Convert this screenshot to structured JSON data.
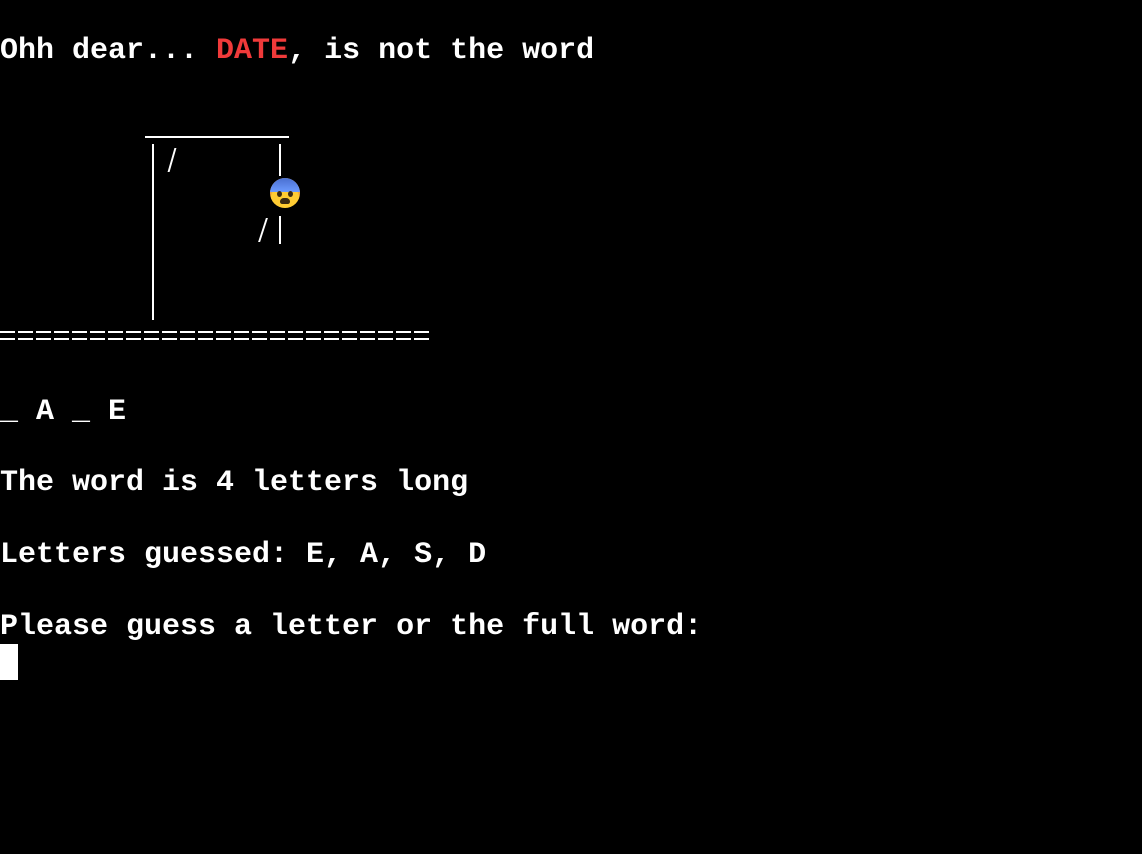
{
  "status": {
    "prefix": "Ohh dear... ",
    "guessed_word": "DATE",
    "suffix": ", is not the word"
  },
  "drawing": {
    "figure_face_icon": "fearful-face-emoji",
    "ground_text": "========================"
  },
  "progress": {
    "pattern": "_ A _ E"
  },
  "info": {
    "length_text": "The word is 4 letters long",
    "letters_guessed_text": "Letters guessed: E, A, S, D"
  },
  "prompt": {
    "text": "Please guess a letter or the full word:",
    "input_value": ""
  },
  "colors": {
    "background": "#000000",
    "text": "#ffffff",
    "wrong_guess": "#f03a3a"
  }
}
